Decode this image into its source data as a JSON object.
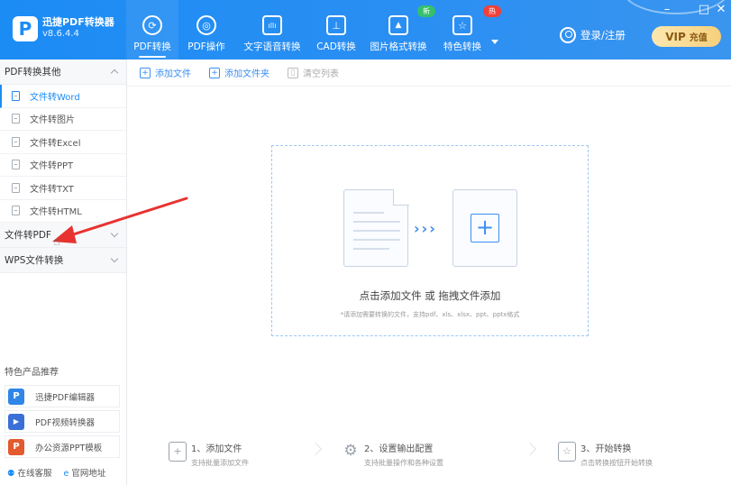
{
  "app": {
    "name": "迅捷PDF转换器",
    "version": "v8.6.4.4",
    "logo_letter": "P"
  },
  "nav": [
    {
      "label": "PDF转换",
      "icon": "convert-icon",
      "glyph": "⟳",
      "active": true
    },
    {
      "label": "PDF操作",
      "icon": "gear-icon",
      "glyph": "◎",
      "active": false
    },
    {
      "label": "文字语音转换",
      "icon": "audio-wave-icon",
      "glyph": "ıllı",
      "active": false
    },
    {
      "label": "CAD转换",
      "icon": "cad-icon",
      "glyph": "⊥",
      "active": false
    },
    {
      "label": "图片格式转换",
      "icon": "image-icon",
      "glyph": "▲",
      "active": false
    },
    {
      "label": "特色转换",
      "icon": "star-icon",
      "glyph": "☆",
      "active": false
    }
  ],
  "badges": {
    "new": "新",
    "hot": "热"
  },
  "header": {
    "login": "登录/注册",
    "vip": "VIP",
    "recharge": "充值"
  },
  "sidebar": {
    "group1": "PDF转换其他",
    "items": [
      "文件转Word",
      "文件转图片",
      "文件转Excel",
      "文件转PPT",
      "文件转TXT",
      "文件转HTML"
    ],
    "group2": "文件转PDF",
    "group3": "WPS文件转换",
    "rec_title": "特色产品推荐",
    "rec": [
      {
        "label": "迅捷PDF编辑器",
        "color": "#2f86e8",
        "glyph": "P"
      },
      {
        "label": "PDF视频转换器",
        "color": "#3b6fd8",
        "glyph": "▶"
      },
      {
        "label": "办公资源PPT模板",
        "color": "#e25a2d",
        "glyph": "P"
      }
    ],
    "service": "在线客服",
    "website": "官网地址"
  },
  "toolbar": {
    "add_file": "添加文件",
    "add_folder": "添加文件夹",
    "clear": "清空列表"
  },
  "dropzone": {
    "main": "点击添加文件 或 拖拽文件添加",
    "hint": "*请添加需要转换的文件，支持pdf、xls、xlsx、ppt、pptx格式",
    "arrows": "›››",
    "plus": "+"
  },
  "steps": [
    {
      "title": "1、添加文件",
      "sub": "支持批量添加文件",
      "glyph": "+"
    },
    {
      "title": "2、设置输出配置",
      "sub": "支持批量操作和各种设置",
      "glyph": "⚙"
    },
    {
      "title": "3、开始转换",
      "sub": "点击转换按钮开始转换",
      "glyph": "☆"
    }
  ],
  "colors": {
    "primary": "#1c8cf5",
    "annotation": "#e8322f"
  }
}
